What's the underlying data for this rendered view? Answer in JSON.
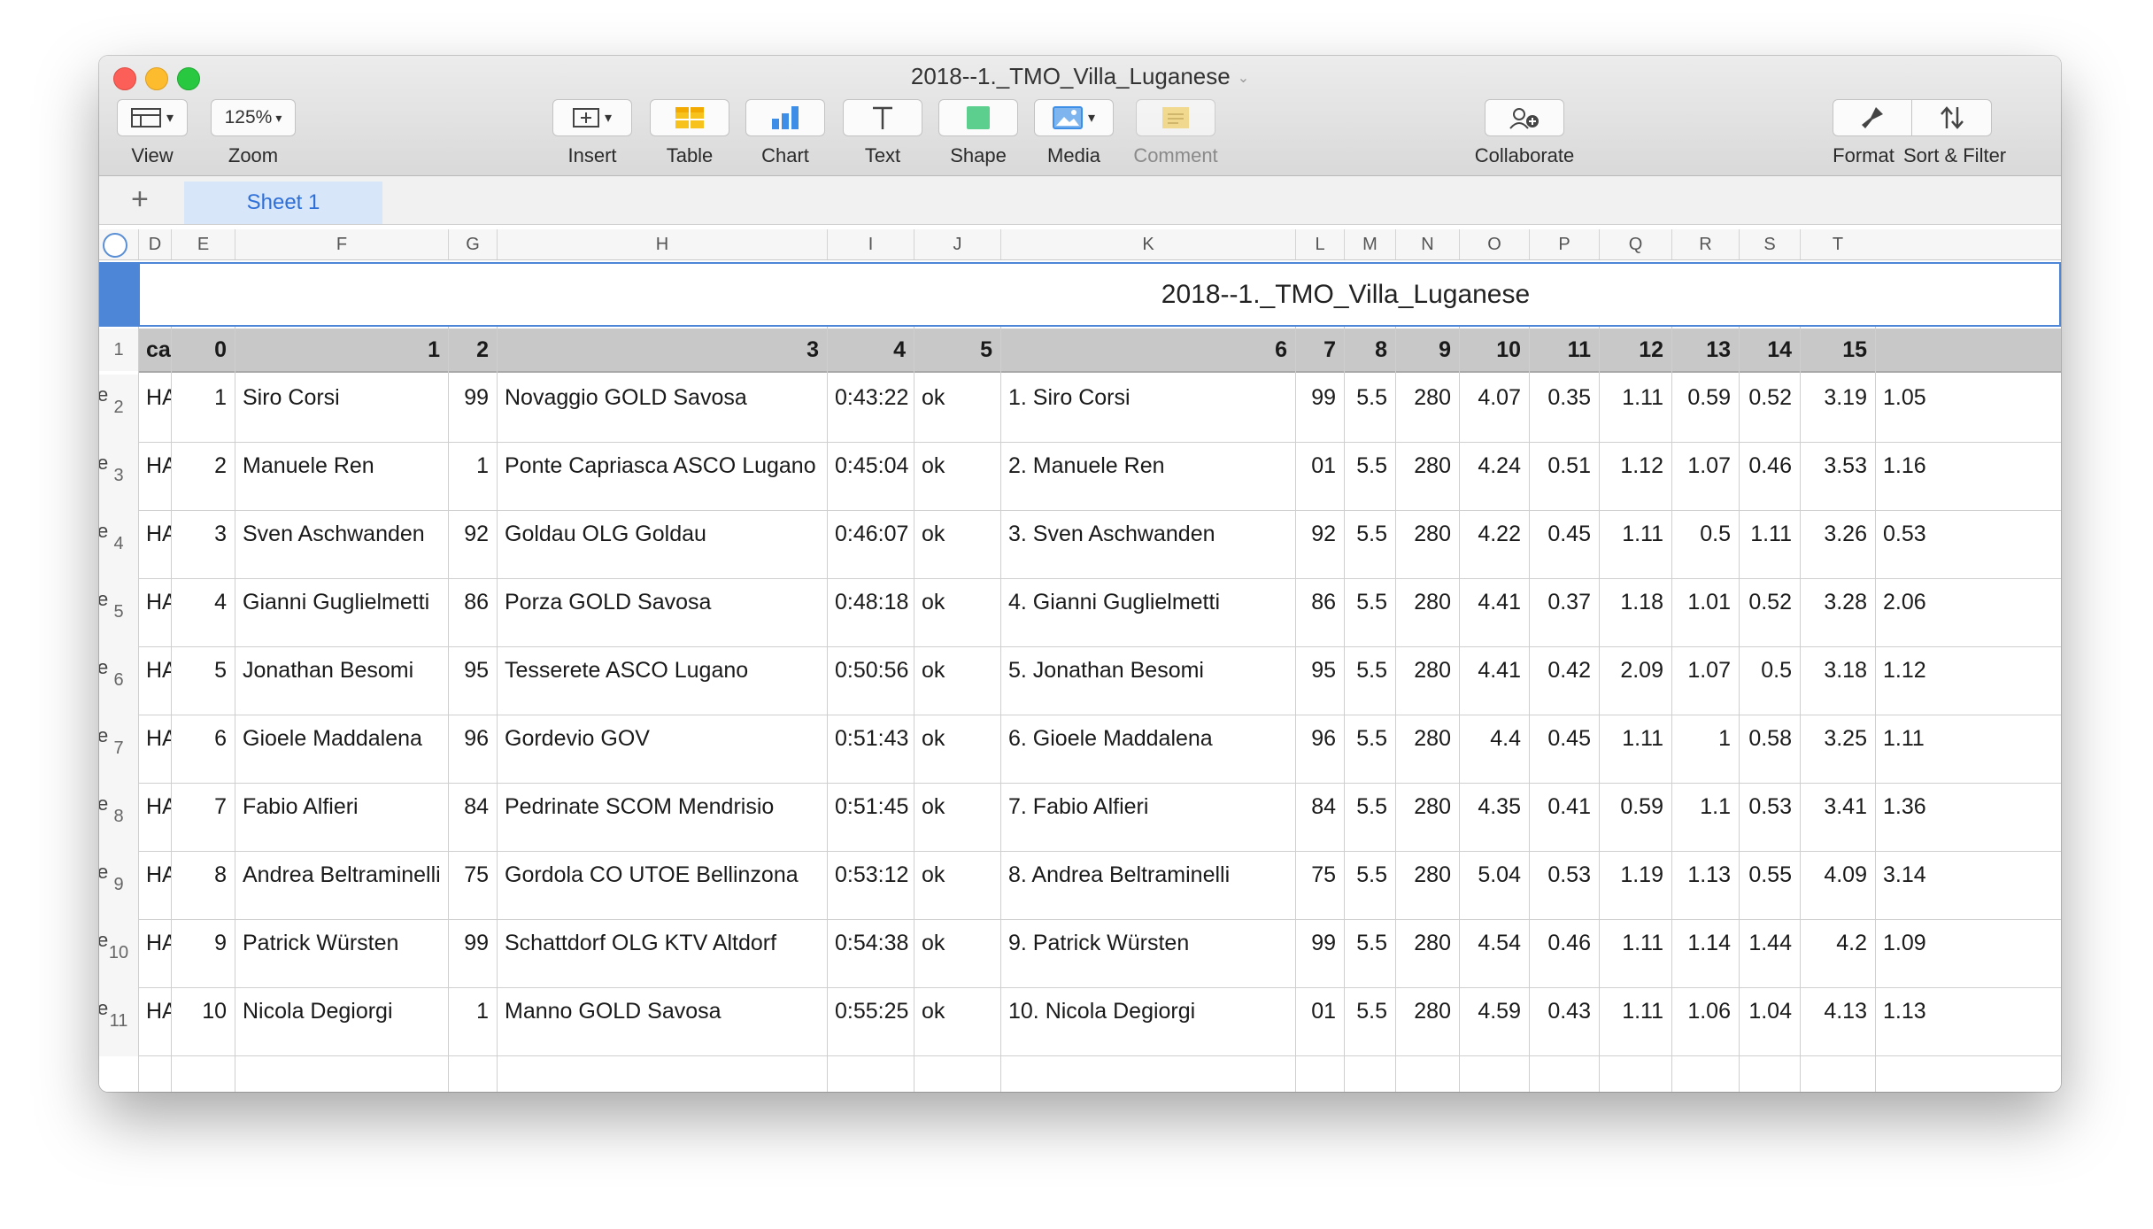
{
  "window": {
    "title": "2018--1._TMO_Villa_Luganese"
  },
  "toolbar": {
    "view_label": "View",
    "zoom_value": "125%",
    "zoom_label": "Zoom",
    "insert_label": "Insert",
    "table_label": "Table",
    "chart_label": "Chart",
    "text_label": "Text",
    "shape_label": "Shape",
    "media_label": "Media",
    "comment_label": "Comment",
    "collaborate_label": "Collaborate",
    "format_label": "Format",
    "sort_label": "Sort & Filter"
  },
  "tabs": {
    "add": "+",
    "sheet1": "Sheet 1"
  },
  "sheet": {
    "title": "2018--1._TMO_Villa_Luganese",
    "column_letters": [
      "D",
      "E",
      "F",
      "G",
      "H",
      "I",
      "J",
      "K",
      "L",
      "M",
      "N",
      "O",
      "P",
      "Q",
      "R",
      "S",
      "T"
    ],
    "header_row_num": "1",
    "headers": [
      "cat",
      "0",
      "1",
      "2",
      "3",
      "4",
      "5",
      "6",
      "7",
      "8",
      "9",
      "10",
      "11",
      "12",
      "13",
      "14",
      "15"
    ],
    "rows": [
      {
        "num": "2",
        "cells": [
          "HAL",
          "1",
          "Siro Corsi",
          "99",
          "Novaggio GOLD Savosa",
          "0:43:22",
          "ok",
          "1. Siro Corsi",
          "99",
          "5.5",
          "280",
          "4.07",
          "0.35",
          "1.11",
          "0.59",
          "0.52",
          "3.19",
          "1.05"
        ]
      },
      {
        "num": "3",
        "cells": [
          "HAL",
          "2",
          "Manuele Ren",
          "1",
          "Ponte Capriasca ASCO Lugano",
          "0:45:04",
          "ok",
          "2. Manuele Ren",
          "01",
          "5.5",
          "280",
          "4.24",
          "0.51",
          "1.12",
          "1.07",
          "0.46",
          "3.53",
          "1.16"
        ]
      },
      {
        "num": "4",
        "cells": [
          "HAL",
          "3",
          "Sven Aschwanden",
          "92",
          "Goldau OLG Goldau",
          "0:46:07",
          "ok",
          "3. Sven Aschwanden",
          "92",
          "5.5",
          "280",
          "4.22",
          "0.45",
          "1.11",
          "0.5",
          "1.11",
          "3.26",
          "0.53"
        ]
      },
      {
        "num": "5",
        "cells": [
          "HAL",
          "4",
          "Gianni Guglielmetti",
          "86",
          "Porza GOLD Savosa",
          "0:48:18",
          "ok",
          "4. Gianni Guglielmetti",
          "86",
          "5.5",
          "280",
          "4.41",
          "0.37",
          "1.18",
          "1.01",
          "0.52",
          "3.28",
          "2.06"
        ]
      },
      {
        "num": "6",
        "cells": [
          "HAL",
          "5",
          "Jonathan Besomi",
          "95",
          "Tesserete ASCO Lugano",
          "0:50:56",
          "ok",
          "5. Jonathan Besomi",
          "95",
          "5.5",
          "280",
          "4.41",
          "0.42",
          "2.09",
          "1.07",
          "0.5",
          "3.18",
          "1.12"
        ]
      },
      {
        "num": "7",
        "cells": [
          "HAL",
          "6",
          "Gioele Maddalena",
          "96",
          "Gordevio GOV",
          "0:51:43",
          "ok",
          "6. Gioele Maddalena",
          "96",
          "5.5",
          "280",
          "4.4",
          "0.45",
          "1.11",
          "1",
          "0.58",
          "3.25",
          "1.11"
        ]
      },
      {
        "num": "8",
        "cells": [
          "HAL",
          "7",
          "Fabio Alfieri",
          "84",
          "Pedrinate SCOM Mendrisio",
          "0:51:45",
          "ok",
          "7. Fabio Alfieri",
          "84",
          "5.5",
          "280",
          "4.35",
          "0.41",
          "0.59",
          "1.1",
          "0.53",
          "3.41",
          "1.36"
        ]
      },
      {
        "num": "9",
        "cells": [
          "HAL",
          "8",
          "Andrea Beltraminelli",
          "75",
          "Gordola CO UTOE Bellinzona",
          "0:53:12",
          "ok",
          "8. Andrea Beltraminelli",
          "75",
          "5.5",
          "280",
          "5.04",
          "0.53",
          "1.19",
          "1.13",
          "0.55",
          "4.09",
          "3.14"
        ]
      },
      {
        "num": "10",
        "cells": [
          "HAL",
          "9",
          "Patrick Würsten",
          "99",
          "Schattdorf OLG KTV Altdorf",
          "0:54:38",
          "ok",
          "9. Patrick Würsten",
          "99",
          "5.5",
          "280",
          "4.54",
          "0.46",
          "1.11",
          "1.14",
          "1.44",
          "4.2",
          "1.09"
        ]
      },
      {
        "num": "11",
        "cells": [
          "HAL",
          "10",
          "Nicola Degiorgi",
          "1",
          "Manno GOLD Savosa",
          "0:55:25",
          "ok",
          "10. Nicola Degiorgi",
          "01",
          "5.5",
          "280",
          "4.59",
          "0.43",
          "1.11",
          "1.06",
          "1.04",
          "4.13",
          "1.13"
        ]
      }
    ],
    "clipped_glyph": "e"
  },
  "colors": {
    "selection_blue": "#4d86d6",
    "header_row_gray": "#c8c8c8",
    "tab_active_bg": "#d7e6f9",
    "tab_active_text": "#2e6fd8"
  }
}
